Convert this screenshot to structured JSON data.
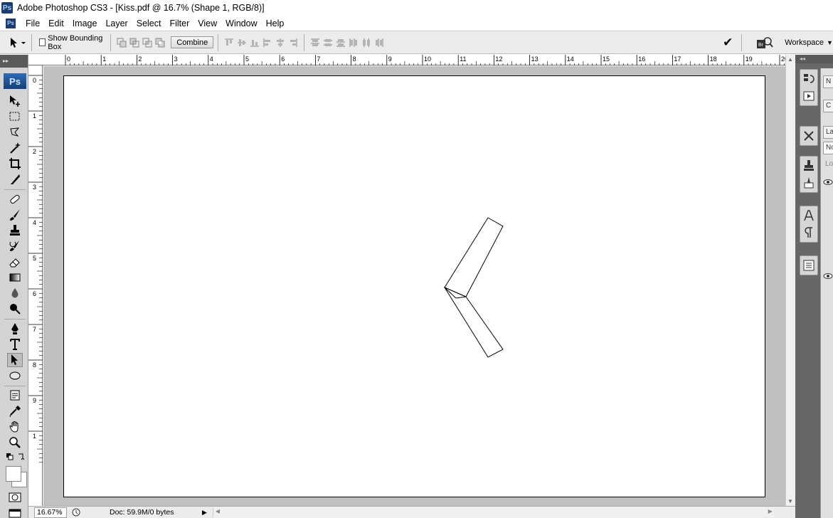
{
  "window": {
    "title": "Adobe Photoshop CS3 - [Kiss.pdf @ 16.7% (Shape 1, RGB/8)]",
    "app_badge": "Ps"
  },
  "menu": [
    "File",
    "Edit",
    "Image",
    "Layer",
    "Select",
    "Filter",
    "View",
    "Window",
    "Help"
  ],
  "options_bar": {
    "show_bounding_box": "Show Bounding Box",
    "show_bounding_box_checked": false,
    "combine": "Combine",
    "workspace": "Workspace"
  },
  "toolbox": {
    "badge": "Ps",
    "active_tool": "path-selection-tool",
    "foreground_color": "#ffffff",
    "background_color": "#ffffff"
  },
  "rulers": {
    "top_labels": [
      "0",
      "1",
      "2",
      "3",
      "4",
      "5",
      "6",
      "7",
      "8",
      "9",
      "10",
      "11",
      "12",
      "13",
      "14",
      "15",
      "16",
      "17",
      "18",
      "19",
      "20"
    ],
    "left_labels": [
      "0",
      "1",
      "2",
      "3",
      "4",
      "5",
      "6",
      "7",
      "8",
      "9",
      "1"
    ]
  },
  "status": {
    "zoom": "16.67%",
    "doc": "Doc: 59.9M/0 bytes"
  },
  "panels": {
    "tabs": [
      "N",
      "C",
      "La",
      "No",
      "Lo"
    ]
  },
  "colors": {
    "pasteboard": "#c0c0c0",
    "toolbox": "#d4d4d4",
    "panel_strip": "#676767",
    "ps_blue": "#1e3d6e"
  }
}
